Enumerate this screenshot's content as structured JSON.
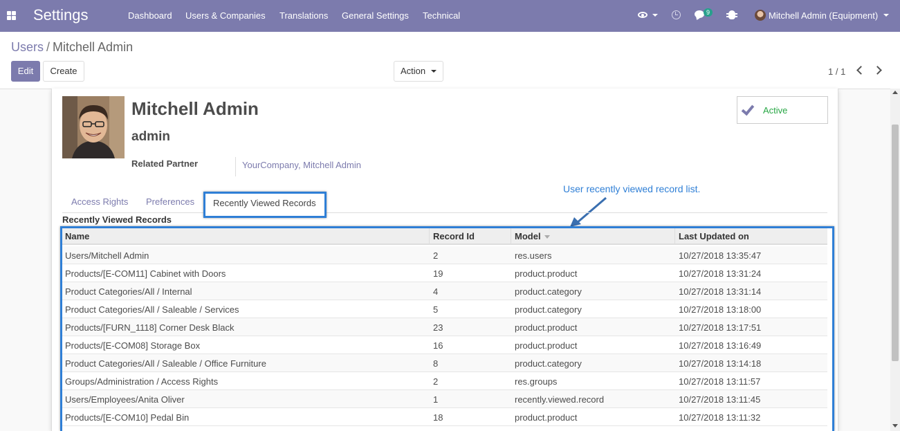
{
  "navbar": {
    "brand": "Settings",
    "menu": [
      "Dashboard",
      "Users & Companies",
      "Translations",
      "General Settings",
      "Technical"
    ],
    "chat_count": "9",
    "user": "Mitchell Admin (Equipment)"
  },
  "breadcrumb": {
    "parent": "Users",
    "separator": "/",
    "current": "Mitchell Admin"
  },
  "buttons": {
    "edit": "Edit",
    "create": "Create",
    "action": "Action"
  },
  "pager": {
    "value": "1 / 1"
  },
  "record": {
    "name": "Mitchell Admin",
    "login": "admin",
    "related_partner_label": "Related Partner",
    "related_partner_value": "YourCompany, Mitchell Admin",
    "active_label": "Active"
  },
  "tabs": [
    "Access Rights",
    "Preferences",
    "Recently Viewed Records"
  ],
  "section_title": "Recently Viewed Records",
  "annotation": "User recently viewed record list.",
  "table": {
    "headers": [
      "Name",
      "Record Id",
      "Model",
      "Last Updated on"
    ],
    "rows": [
      [
        "Users/Mitchell Admin",
        "2",
        "res.users",
        "10/27/2018 13:35:47"
      ],
      [
        "Products/[E-COM11] Cabinet with Doors",
        "19",
        "product.product",
        "10/27/2018 13:31:24"
      ],
      [
        "Product Categories/All / Internal",
        "4",
        "product.category",
        "10/27/2018 13:31:14"
      ],
      [
        "Product Categories/All / Saleable / Services",
        "5",
        "product.category",
        "10/27/2018 13:18:00"
      ],
      [
        "Products/[FURN_1118] Corner Desk Black",
        "23",
        "product.product",
        "10/27/2018 13:17:51"
      ],
      [
        "Products/[E-COM08] Storage Box",
        "16",
        "product.product",
        "10/27/2018 13:16:49"
      ],
      [
        "Product Categories/All / Saleable / Office Furniture",
        "8",
        "product.category",
        "10/27/2018 13:14:18"
      ],
      [
        "Groups/Administration / Access Rights",
        "2",
        "res.groups",
        "10/27/2018 13:11:57"
      ],
      [
        "Users/Employees/Anita Oliver",
        "1",
        "recently.viewed.record",
        "10/27/2018 13:11:45"
      ],
      [
        "Products/[E-COM10] Pedal Bin",
        "18",
        "product.product",
        "10/27/2018 13:11:32"
      ]
    ]
  },
  "colors": {
    "primary": "#7c7bad",
    "highlight": "#2f7fd6",
    "active": "#28a745"
  }
}
